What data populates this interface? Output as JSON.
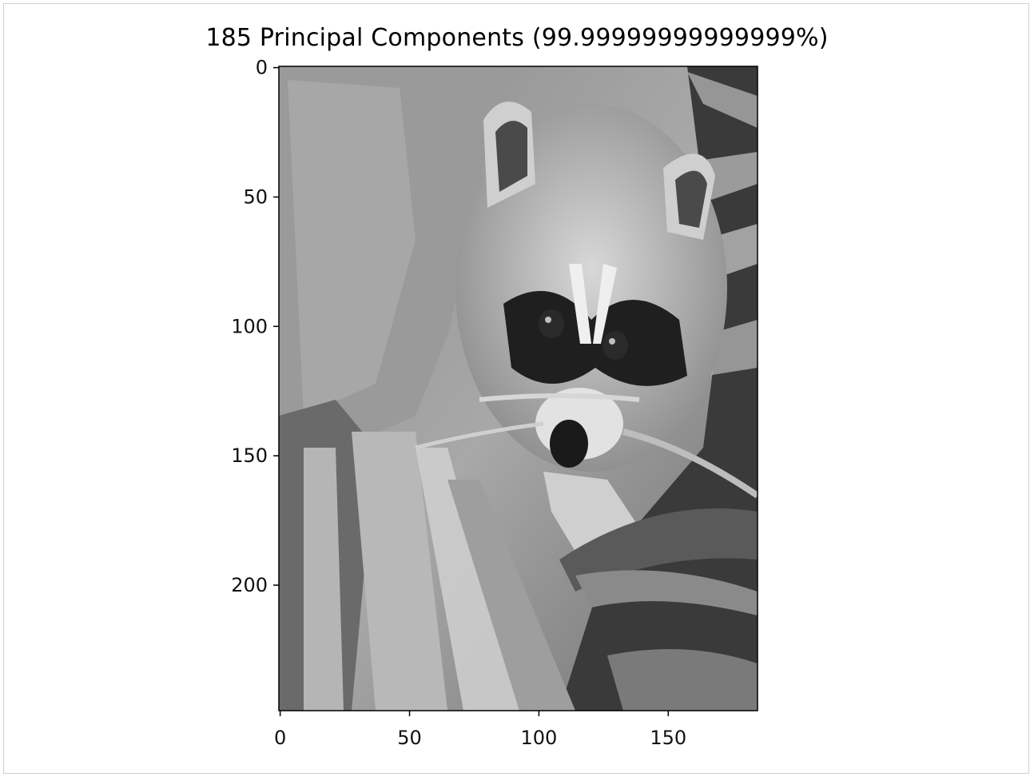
{
  "chart_data": {
    "type": "image",
    "title": "185 Principal Components (99.99999999999999%)",
    "subject": "grayscale photograph of a raccoon among palm leaves",
    "image_width": 185,
    "image_height": 249,
    "xlim": [
      -0.5,
      184.5
    ],
    "ylim": [
      248.5,
      -0.5
    ],
    "x_ticks": [
      0,
      50,
      100,
      150
    ],
    "y_ticks": [
      0,
      50,
      100,
      150,
      200
    ],
    "x_tick_labels": [
      "0",
      "50",
      "100",
      "150"
    ],
    "y_tick_labels": [
      "0",
      "50",
      "100",
      "150",
      "200"
    ],
    "colormap": "gray",
    "grid": false
  }
}
